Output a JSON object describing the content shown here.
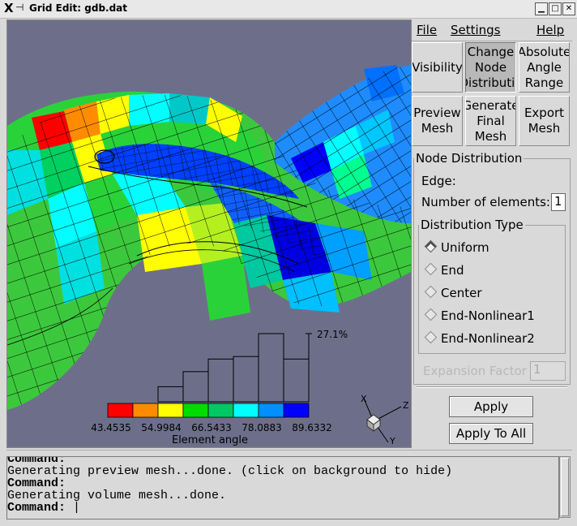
{
  "window": {
    "title": "Grid Edit: gdb.dat",
    "logo": "X",
    "controls": [
      "▁",
      "□",
      "✕"
    ]
  },
  "menu": {
    "file": "File",
    "settings": "Settings",
    "help": "Help"
  },
  "buttons": {
    "visibility": "Visibility",
    "change_node_distribution": "Change\nNode\nDistributio",
    "absolute_angle_range": "Absolute\nAngle\nRange",
    "preview_mesh": "Preview\nMesh",
    "generate_final_mesh": "Generate\nFinal\nMesh",
    "export_mesh": "Export\nMesh"
  },
  "node_distribution": {
    "legend": "Node Distribution",
    "edge_label": "Edge:",
    "num_elements_label": "Number of elements:",
    "num_elements_value": "1",
    "distribution_type": {
      "legend": "Distribution Type",
      "options": [
        "Uniform",
        "End",
        "Center",
        "End-Nonlinear1",
        "End-Nonlinear2"
      ],
      "selected": "Uniform"
    },
    "expansion_factor_label": "Expansion Factor",
    "expansion_factor_value": "1",
    "apply": "Apply",
    "apply_to_all": "Apply To All"
  },
  "histogram": {
    "max_label": "27.1%",
    "tick_labels": [
      "43.4535",
      "54.9984",
      "66.5433",
      "78.0883",
      "89.6332"
    ],
    "axis_label": "Element angle",
    "bin_colors": [
      "#ff0000",
      "#ff8c00",
      "#ffff00",
      "#00dc00",
      "#00c864",
      "#00ffff",
      "#0090ff",
      "#0000ff"
    ],
    "bin_heights_percent": [
      0,
      0,
      6,
      12,
      17,
      18,
      27.1,
      17
    ]
  },
  "axes_triad": {
    "x": "X",
    "y": "Y",
    "z": "Z"
  },
  "console": {
    "lines": [
      {
        "text": "Command:",
        "bold": true
      },
      {
        "text": "Generating preview mesh...done. (click on background to hide)",
        "bold": false
      },
      {
        "text": "Command:",
        "bold": true
      },
      {
        "text": "Generating volume mesh...done.",
        "bold": false
      },
      {
        "text": "Command:",
        "bold": true
      }
    ]
  },
  "colors": {
    "background": "#6d6f8a",
    "panel": "#d9d9d9"
  }
}
